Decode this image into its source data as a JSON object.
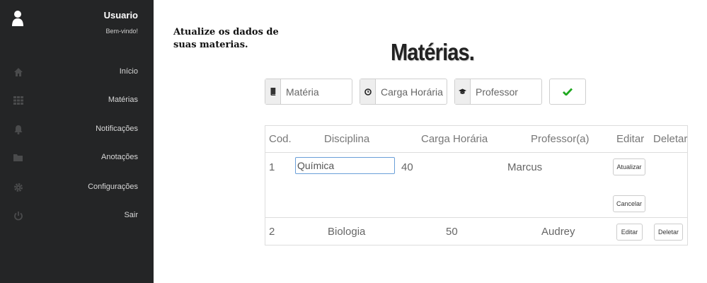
{
  "sidebar": {
    "user_name": "Usuario",
    "welcome": "Bem-vindo!",
    "items": [
      {
        "icon": "home-icon",
        "label": "Início"
      },
      {
        "icon": "grid-icon",
        "label": "Matérias"
      },
      {
        "icon": "bell-icon",
        "label": "Notificações"
      },
      {
        "icon": "folder-icon",
        "label": "Anotações"
      },
      {
        "icon": "gear-icon",
        "label": "Configurações"
      },
      {
        "icon": "power-icon",
        "label": "Sair"
      }
    ]
  },
  "main": {
    "hint": "Atualize os dados de suas materias.",
    "title": "Matérias.",
    "form": {
      "materia_placeholder": "Matéria",
      "carga_placeholder": "Carga Horária",
      "professor_placeholder": "Professor"
    },
    "table": {
      "headers": [
        "Cod.",
        "Disciplina",
        "Carga Horária",
        "Professor(a)",
        "Editar",
        "Deletar"
      ],
      "rows": [
        {
          "cod": "1",
          "disciplina": "Química",
          "carga": "40",
          "professor": "Marcus",
          "update_label": "Atualizar",
          "cancel_label": "Cancelar"
        },
        {
          "cod": "2",
          "disciplina": "Biologia",
          "carga": "50",
          "professor": "Audrey",
          "edit_label": "Editar",
          "delete_label": "Deletar"
        }
      ]
    }
  },
  "colors": {
    "sidebar_bg": "#242526",
    "accent_green": "#1fa81f",
    "focus_blue": "#6a9fd8"
  }
}
